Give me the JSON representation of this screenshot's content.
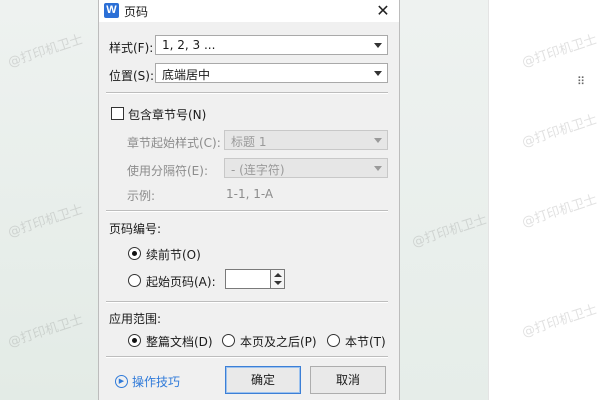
{
  "dialog": {
    "app_icon": "W",
    "title": "页码",
    "close": "✕"
  },
  "style": {
    "label": "样式(F):",
    "value": "1, 2, 3 ..."
  },
  "position": {
    "label": "位置(S):",
    "value": "底端居中"
  },
  "chapter": {
    "checkbox_label": "包含章节号(N)",
    "checked": false,
    "start_style_label": "章节起始样式(C):",
    "start_style_value": "标题 1",
    "separator_label": "使用分隔符(E):",
    "separator_value": "-   (连字符)",
    "example_label": "示例:",
    "example_value": "1-1, 1-A"
  },
  "numbering": {
    "section_label": "页码编号:",
    "continue_label": "续前节(O)",
    "start_label": "起始页码(A):",
    "start_value": "",
    "selected": "continue"
  },
  "scope": {
    "section_label": "应用范围:",
    "options": [
      "整篇文档(D)",
      "本页及之后(P)",
      "本节(T)"
    ],
    "selected": "整篇文档(D)"
  },
  "footer": {
    "help_label": "操作技巧",
    "ok_label": "确定",
    "cancel_label": "取消"
  },
  "watermark": "@打印机卫士",
  "colors": {
    "accent": "#2f7ad9",
    "dialog_bg": "#f0f0f0"
  }
}
